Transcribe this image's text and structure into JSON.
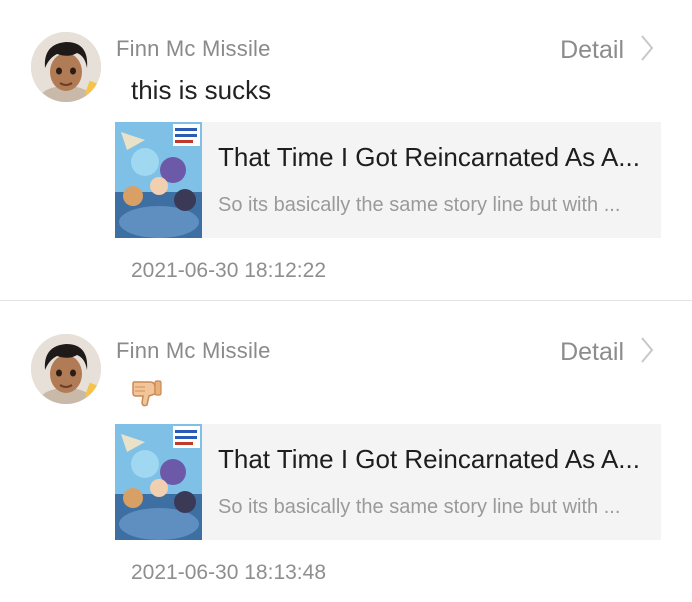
{
  "feed": [
    {
      "username": "Finn Mc Missile",
      "detail_label": "Detail",
      "comment_text": "this is sucks",
      "novel": {
        "title": "That Time I Got Reincarnated As A...",
        "description": "So its basically the same story line but with ..."
      },
      "timestamp": "2021-06-30 18:12:22"
    },
    {
      "username": "Finn Mc Missile",
      "detail_label": "Detail",
      "reaction_icon": "thumbs-down-icon",
      "novel": {
        "title": "That Time I Got Reincarnated As A...",
        "description": "So its basically the same story line but with ..."
      },
      "timestamp": "2021-06-30 18:13:48"
    }
  ],
  "colors": {
    "card_background": "#f4f4f4",
    "secondary_text": "#8a8a8a",
    "primary_text": "#222222",
    "thumb_color": "#f2c49a"
  }
}
